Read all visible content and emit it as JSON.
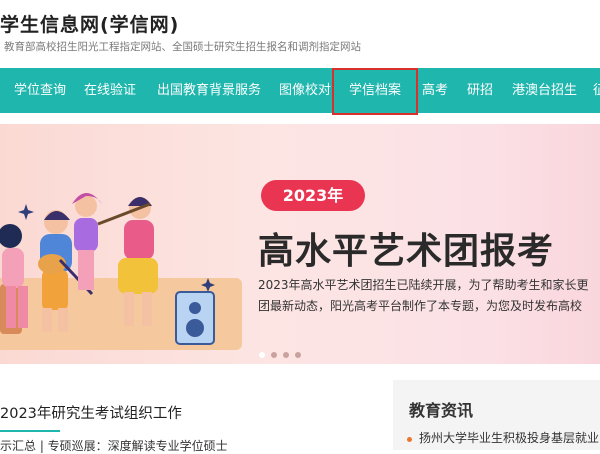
{
  "header": {
    "title": "学生信息网(学信网)",
    "subtitle": "教育部高校招生阳光工程指定网站、全国硕士研究生招生报名和调剂指定网站"
  },
  "nav": {
    "items": [
      "学位查询",
      "在线验证",
      "出国教育背景服务",
      "图像校对",
      "学信档案",
      "高考",
      "研招",
      "港澳台招生",
      "征"
    ],
    "highlighted": "学信档案"
  },
  "banner": {
    "badge": "2023年",
    "headline": "高水平艺术团报考",
    "desc_line1": "2023年高水平艺术团招生已陆续开展，为了帮助考生和家长更",
    "desc_line2": "团最新动态，阳光高考平台制作了本专题，为您及时发布高校",
    "slide_count": 4,
    "active_slide": 1
  },
  "left_panel": {
    "title": "2023年研究生考试组织工作",
    "links": "示汇总 | 专硕巡展：深度解读专业学位硕士"
  },
  "right_panel": {
    "title": "教育资讯",
    "items": [
      "扬州大学毕业生积极投身基层就业"
    ]
  },
  "colors": {
    "nav_bg": "#1fb6ad",
    "highlight_border": "#d9302b",
    "badge_bg": "#e93551"
  }
}
